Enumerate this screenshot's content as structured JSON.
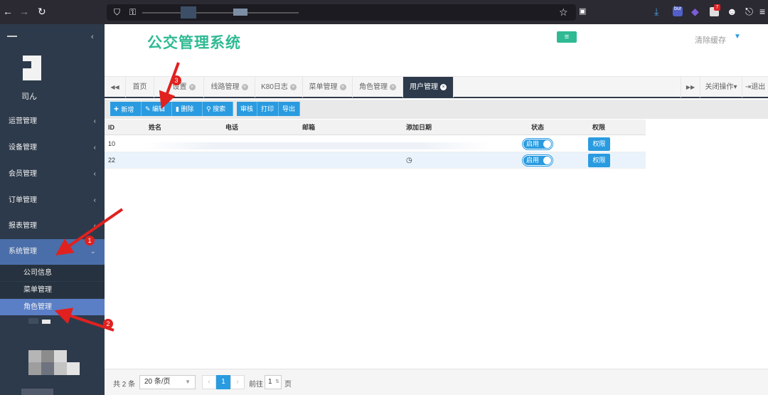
{
  "browser": {
    "back_icon": "arrow-left-icon",
    "forward_icon": "arrow-right-icon",
    "reload_icon": "reload-icon",
    "star_icon": "star-icon",
    "badge_count": "7",
    "ext_label": "bur"
  },
  "sidebar": {
    "user_name": "司ん",
    "items": [
      {
        "label": "运营管理"
      },
      {
        "label": "设备管理"
      },
      {
        "label": "会员管理"
      },
      {
        "label": "订单管理"
      },
      {
        "label": "报表管理"
      },
      {
        "label": "系统管理"
      }
    ],
    "sub_items": [
      {
        "label": "公司信息"
      },
      {
        "label": "菜单管理"
      },
      {
        "label": "角色管理"
      }
    ]
  },
  "header": {
    "title": "公交管理系统",
    "menu_icon": "≡",
    "clear_cache": "清除缓存",
    "caret": "▼"
  },
  "tabs": {
    "prev": "◀◀",
    "items": [
      {
        "label": "首页"
      },
      {
        "label": "设置"
      },
      {
        "label": "线路管理"
      },
      {
        "label": "K80日志"
      },
      {
        "label": "菜单管理"
      },
      {
        "label": "角色管理"
      },
      {
        "label": "用户管理"
      }
    ],
    "next": "▶▶",
    "close_ops": "关闭操作▾",
    "logout": "退出"
  },
  "toolbar": {
    "add": "新增",
    "edit": "编辑",
    "delete": "删除",
    "search": "搜索",
    "review": "审核",
    "print": "打印",
    "export": "导出"
  },
  "table": {
    "headers": {
      "id": "ID",
      "name": "姓名",
      "phone": "电话",
      "email": "邮箱",
      "date": "添加日期",
      "status": "状态",
      "perm": "权限"
    },
    "rows": [
      {
        "id": "10",
        "date": "",
        "status": "启用",
        "perm": "权限"
      },
      {
        "id": "22",
        "date": "◷",
        "status": "启用",
        "perm": "权限"
      }
    ]
  },
  "pagination": {
    "total": "共 2 条",
    "page_size": "20 条/页",
    "prev": "‹",
    "current": "1",
    "next": "›",
    "goto": "前往",
    "goto_value": "1",
    "page_suffix": "页"
  },
  "annotations": [
    "1",
    "2",
    "3"
  ],
  "colors": {
    "accent": "#2a9be0",
    "title": "#2fba93",
    "sidebar": "#2d3a4b",
    "arrow": "#e0211f"
  }
}
